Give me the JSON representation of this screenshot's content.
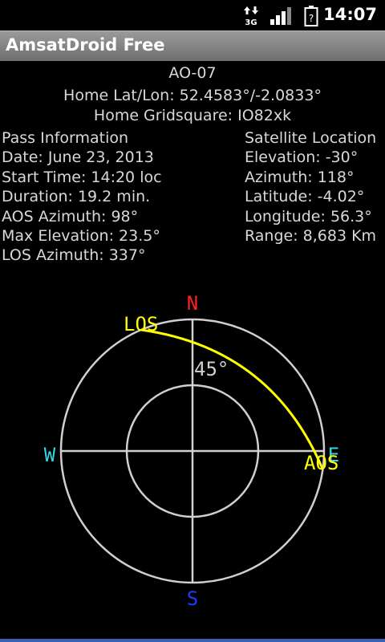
{
  "status_bar": {
    "time": "14:07",
    "network_label": "3G",
    "icons": [
      "transfer-arrows-icon",
      "signal-strength-icon",
      "battery-unknown-icon"
    ]
  },
  "title_bar": {
    "title": "AmsatDroid Free"
  },
  "satellite": {
    "name": "AO-07",
    "home_latlon": "Home Lat/Lon: 52.4583°/-2.0833°",
    "home_grid": "Home Gridsquare: IO82xk"
  },
  "pass_info": {
    "heading": "Pass Information",
    "date": "Date: June 23, 2013",
    "start_time": "Start Time: 14:20 loc",
    "duration": "Duration: 19.2 min.",
    "aos_azimuth": "AOS Azimuth: 98°",
    "max_elevation": "Max Elevation: 23.5°",
    "los_azimuth": "LOS Azimuth: 337°"
  },
  "satellite_location": {
    "heading": "Satellite Location",
    "elevation": "Elevation: -30°",
    "azimuth": "Azimuth: 118°",
    "latitude": "Latitude: -4.02°",
    "longitude": "Longitude: 56.3°",
    "range": "Range: 8,683 Km"
  },
  "polar_plot": {
    "north": "N",
    "south": "S",
    "east": "E",
    "west": "W",
    "ring_label": "45°",
    "aos_label": "AOS",
    "los_label": "LOS",
    "colors": {
      "north": "#ff2020",
      "south": "#1a3cff",
      "east_west": "#33d6e6",
      "track": "#ffff00",
      "grid": "#d0d0d0"
    },
    "pass_track": {
      "aos_azimuth_deg": 98,
      "los_azimuth_deg": 337,
      "max_elevation_deg": 23.5
    }
  }
}
